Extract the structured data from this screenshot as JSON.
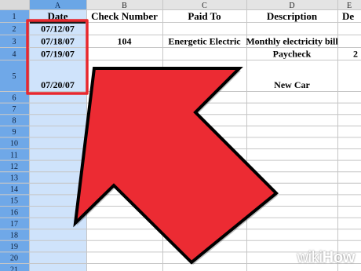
{
  "columns": [
    {
      "letter": "A",
      "header": "Date",
      "selected": true
    },
    {
      "letter": "B",
      "header": "Check Number",
      "selected": false
    },
    {
      "letter": "C",
      "header": "Paid To",
      "selected": false
    },
    {
      "letter": "D",
      "header": "Description",
      "selected": false
    },
    {
      "letter": "E",
      "header": "De",
      "selected": false
    }
  ],
  "row_numbers": [
    "1",
    "2",
    "3",
    "4",
    "5",
    "6",
    "7",
    "8",
    "9",
    "10",
    "11",
    "12",
    "13",
    "14",
    "15",
    "16",
    "17",
    "18",
    "19",
    "20",
    "21"
  ],
  "rows": [
    {
      "date": "07/12/07",
      "check": "",
      "paid_to": "",
      "description": "",
      "extra": ""
    },
    {
      "date": "07/18/07",
      "check": "104",
      "paid_to": "Energetic Electric",
      "description": "Monthly electricity bill",
      "extra": ""
    },
    {
      "date": "07/19/07",
      "check": "",
      "paid_to": "",
      "description": "Paycheck",
      "extra": "2"
    },
    {
      "date": "07/20/07",
      "check": "",
      "paid_to": "",
      "description": "New Car",
      "extra": ""
    }
  ],
  "colors": {
    "selected_header": "#6aa6e6",
    "selected_column": "#cfe3fb",
    "highlight_box": "#e8282e",
    "arrow_fill": "#ec2b33",
    "grid": "#c6c6c6"
  },
  "watermark": {
    "prefix": "wiki",
    "suffix": "How"
  }
}
